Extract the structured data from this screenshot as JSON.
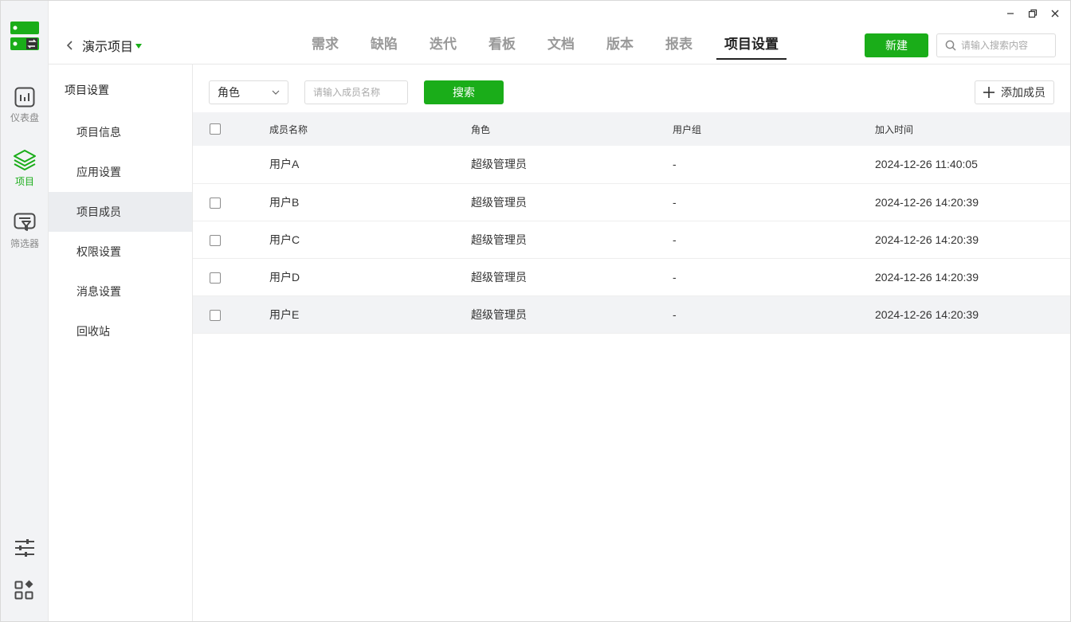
{
  "sidebar": {
    "items": [
      {
        "label": "仪表盘",
        "icon": "dashboard-icon"
      },
      {
        "label": "项目",
        "icon": "layers-icon"
      },
      {
        "label": "筛选器",
        "icon": "filter-icon"
      }
    ],
    "bottom_icons": [
      "sliders-icon",
      "apps-icon"
    ]
  },
  "header": {
    "project_name": "演示项目",
    "tabs": [
      {
        "label": "需求"
      },
      {
        "label": "缺陷"
      },
      {
        "label": "迭代"
      },
      {
        "label": "看板"
      },
      {
        "label": "文档"
      },
      {
        "label": "版本"
      },
      {
        "label": "报表"
      },
      {
        "label": "项目设置"
      }
    ],
    "active_tab": "项目设置",
    "new_button": "新建",
    "search_placeholder": "请输入搜索内容"
  },
  "subnav": {
    "title": "项目设置",
    "items": [
      {
        "label": "项目信息"
      },
      {
        "label": "应用设置"
      },
      {
        "label": "项目成员"
      },
      {
        "label": "权限设置"
      },
      {
        "label": "消息设置"
      },
      {
        "label": "回收站"
      }
    ],
    "active": "项目成员"
  },
  "toolbar": {
    "role_select_value": "角色",
    "member_placeholder": "请输入成员名称",
    "search_button": "搜索",
    "add_member_button": "添加成员"
  },
  "table": {
    "columns": [
      "成员名称",
      "角色",
      "用户组",
      "加入时间"
    ],
    "rows": [
      {
        "name": "用户A",
        "role": "超级管理员",
        "group": "-",
        "joined": "2024-12-26 11:40:05",
        "checkbox": false
      },
      {
        "name": "用户B",
        "role": "超级管理员",
        "group": "-",
        "joined": "2024-12-26 14:20:39",
        "checkbox": true
      },
      {
        "name": "用户C",
        "role": "超级管理员",
        "group": "-",
        "joined": "2024-12-26 14:20:39",
        "checkbox": true
      },
      {
        "name": "用户D",
        "role": "超级管理员",
        "group": "-",
        "joined": "2024-12-26 14:20:39",
        "checkbox": true
      },
      {
        "name": "用户E",
        "role": "超级管理员",
        "group": "-",
        "joined": "2024-12-26 14:20:39",
        "checkbox": true
      }
    ]
  },
  "colors": {
    "accent": "#1aad19",
    "sidebar_bg": "#f2f3f5",
    "active_row": "#ebedf0"
  }
}
